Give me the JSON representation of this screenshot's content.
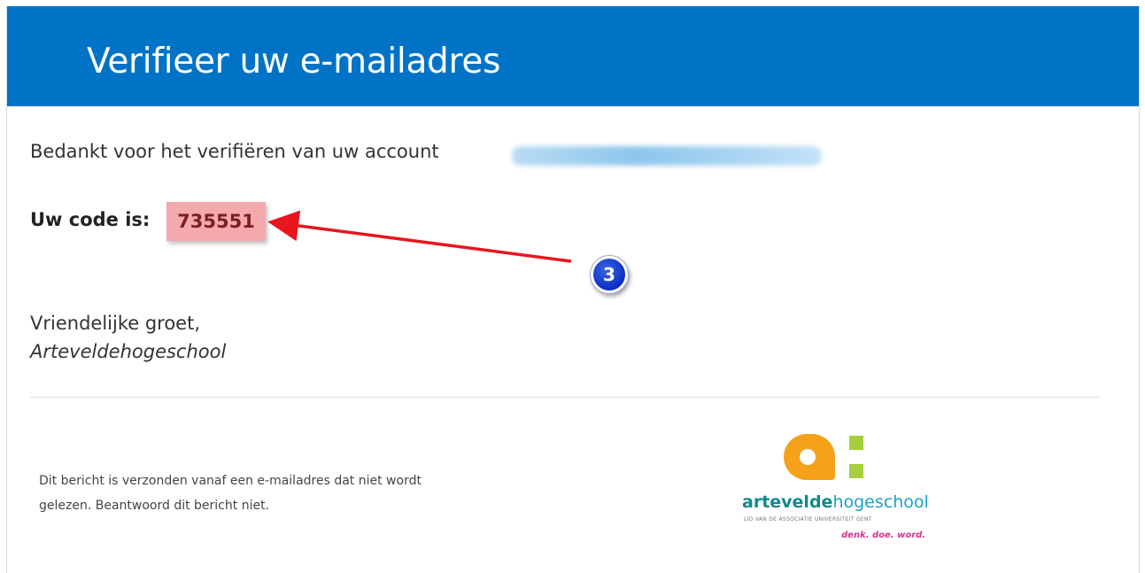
{
  "header": {
    "title": "Verifieer uw e-mailadres"
  },
  "body": {
    "thanks_text": "Bedankt voor het verifiëren van uw account",
    "code_label": "Uw code is:",
    "code_value": "735551",
    "greeting": "Vriendelijke groet,",
    "signature": "Arteveldehogeschool"
  },
  "annotation": {
    "badge_number": "3"
  },
  "footer": {
    "note_line1": "Dit bericht is verzonden vanaf een e-mailadres dat niet wordt",
    "note_line2": "gelezen. Beantwoord dit bericht niet."
  },
  "logo": {
    "name_bold": "artevelde",
    "name_light": "hogeschool",
    "subtitle": "LID VAN DE ASSOCIATIE UNIVERSITEIT GENT",
    "slogan": "denk. doe. word."
  },
  "colors": {
    "header_bg": "#0173c6",
    "highlight": "#f4a9ad",
    "arrow": "#e8161e",
    "badge": "#1537d0",
    "logo_orange": "#f6a11a",
    "logo_green": "#a7cf3d",
    "logo_teal": "#0f8a8c",
    "slogan_pink": "#d6338f"
  }
}
